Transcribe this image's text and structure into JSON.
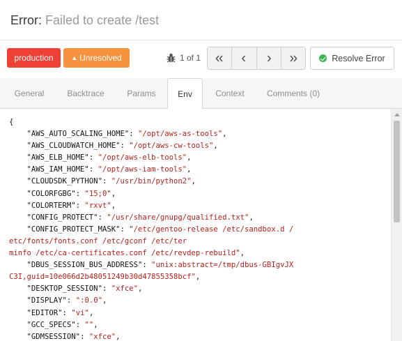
{
  "header": {
    "label": "Error:",
    "message": "Failed to create /test"
  },
  "toolbar": {
    "environment_badge": "production",
    "status_badge": "Unresolved",
    "counter": "1 of 1",
    "resolve_label": "Resolve Error"
  },
  "tabs": [
    {
      "label": "General"
    },
    {
      "label": "Backtrace"
    },
    {
      "label": "Params"
    },
    {
      "label": "Env"
    },
    {
      "label": "Context"
    },
    {
      "label": "Comments (0)"
    }
  ],
  "active_tab": "Env",
  "env": {
    "open": "{",
    "lines": [
      {
        "key": "\"AWS_AUTO_SCALING_HOME\"",
        "value": "\"/opt/aws-as-tools\""
      },
      {
        "key": "\"AWS_CLOUDWATCH_HOME\"",
        "value": "\"/opt/aws-cw-tools\""
      },
      {
        "key": "\"AWS_ELB_HOME\"",
        "value": "\"/opt/aws-elb-tools\""
      },
      {
        "key": "\"AWS_IAM_HOME\"",
        "value": "\"/opt/aws-iam-tools\""
      },
      {
        "key": "\"CLOUDSDK_PYTHON\"",
        "value": "\"/usr/bin/python2\""
      },
      {
        "key": "\"COLORFGBG\"",
        "value": "\"15;0\""
      },
      {
        "key": "\"COLORTERM\"",
        "value": "\"rxvt\""
      },
      {
        "key": "\"CONFIG_PROTECT\"",
        "value": "\"/usr/share/gnupg/qualified.txt\""
      },
      {
        "key": "\"CONFIG_PROTECT_MASK\"",
        "value": "\"/etc/gentoo-release /etc/sandbox.d /etc/fonts/fonts.conf /etc/gconf /etc/terminfo /etc/ca-certificates.conf /etc/revdep-rebuild\""
      },
      {
        "key": "\"DBUS_SESSION_BUS_ADDRESS\"",
        "value": "\"unix:abstract=/tmp/dbus-GBIgvJXC3I,guid=10e066d2b48051249b30d47855358bcf\""
      },
      {
        "key": "\"DESKTOP_SESSION\"",
        "value": "\"xfce\""
      },
      {
        "key": "\"DISPLAY\"",
        "value": "\":0.0\""
      },
      {
        "key": "\"EDITOR\"",
        "value": "\"vi\""
      },
      {
        "key": "\"GCC_SPECS\"",
        "value": "\"\""
      },
      {
        "key": "\"GDMSESSION\"",
        "value": "\"xfce\""
      }
    ]
  },
  "colors": {
    "production": "#ee4035",
    "unresolved": "#f7923e",
    "resolve_check": "#3fb455",
    "json_value": "#b8211b"
  },
  "icons": [
    "bug-icon",
    "first-page-icon",
    "previous-icon",
    "next-icon",
    "last-page-icon",
    "check-circle-icon",
    "warning-icon"
  ]
}
